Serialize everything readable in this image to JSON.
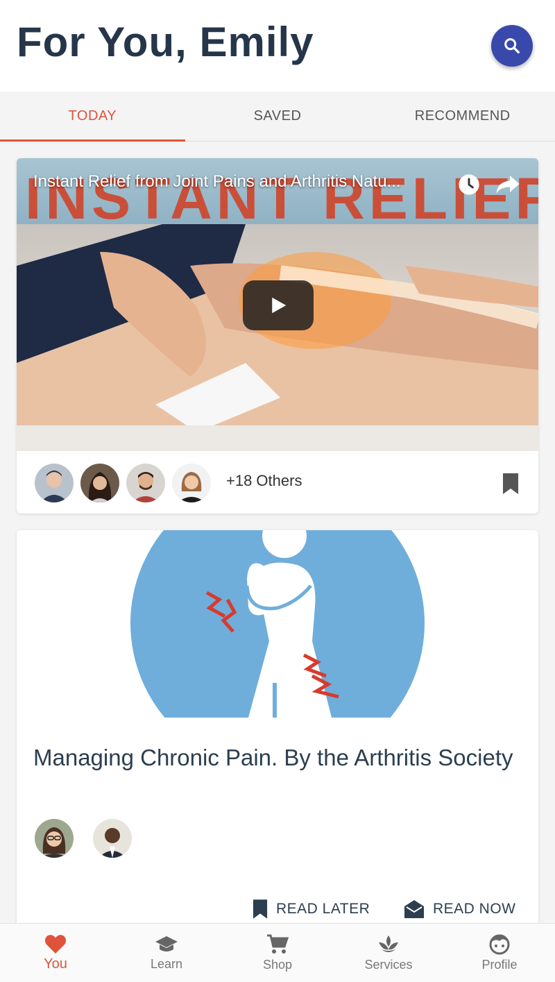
{
  "header": {
    "title": "For You, Emily"
  },
  "tabs": [
    {
      "label": "TODAY",
      "active": true
    },
    {
      "label": "SAVED",
      "active": false
    },
    {
      "label": "RECOMMEND",
      "active": false
    }
  ],
  "video_card": {
    "title": "Instant Relief from Joint Pains and Arthritis Natu...",
    "banner_text": "INSTANT RELIEF",
    "others_label": "+18 Others"
  },
  "article_card": {
    "title": "Managing Chronic Pain. By the Arthritis Society",
    "read_later_label": "READ LATER",
    "read_now_label": "READ NOW"
  },
  "bottom_nav": [
    {
      "label": "You",
      "icon": "heart-icon",
      "active": true
    },
    {
      "label": "Learn",
      "icon": "graduation-cap-icon",
      "active": false
    },
    {
      "label": "Shop",
      "icon": "cart-icon",
      "active": false
    },
    {
      "label": "Services",
      "icon": "lotus-icon",
      "active": false
    },
    {
      "label": "Profile",
      "icon": "face-icon",
      "active": false
    }
  ],
  "colors": {
    "accent": "#e0533a",
    "primary": "#3949ab",
    "text": "#2c3e50",
    "illustration_blue": "#6faedb"
  }
}
